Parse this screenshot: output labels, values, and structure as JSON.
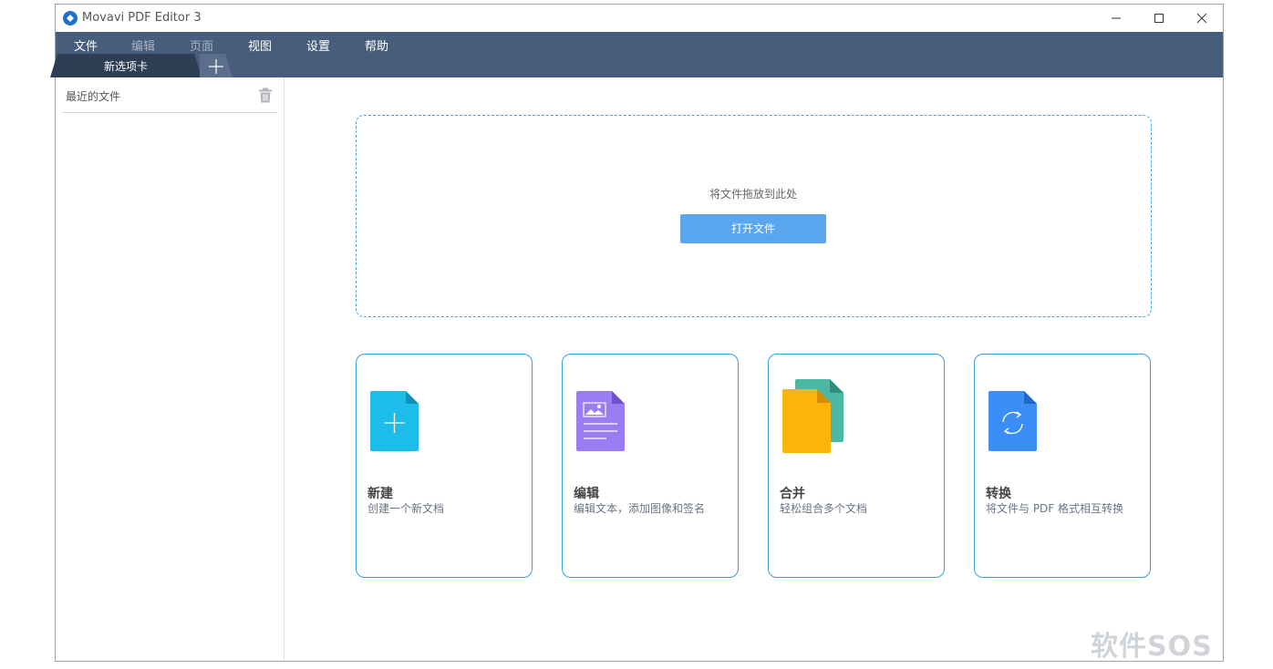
{
  "window": {
    "title": "Movavi PDF Editor 3"
  },
  "menu": {
    "items": [
      {
        "label": "文件",
        "enabled": true
      },
      {
        "label": "编辑",
        "enabled": false
      },
      {
        "label": "页面",
        "enabled": false
      },
      {
        "label": "视图",
        "enabled": true
      },
      {
        "label": "设置",
        "enabled": true
      },
      {
        "label": "帮助",
        "enabled": true
      }
    ]
  },
  "tabs": {
    "active_label": "新选项卡"
  },
  "sidebar": {
    "title": "最近的文件"
  },
  "dropzone": {
    "hint": "将文件拖放到此处",
    "open_button": "打开文件"
  },
  "cards": [
    {
      "title": "新建",
      "desc": "创建一个新文档",
      "icon": "new-document-icon",
      "color": "#1ebde9"
    },
    {
      "title": "编辑",
      "desc": "编辑文本，添加图像和签名",
      "icon": "edit-document-icon",
      "color": "#9b7cf2"
    },
    {
      "title": "合并",
      "desc": "轻松组合多个文档",
      "icon": "merge-documents-icon",
      "color": "#fbb40a"
    },
    {
      "title": "转换",
      "desc": "将文件与 PDF 格式相互转换",
      "icon": "convert-document-icon",
      "color": "#3a8ef5"
    }
  ],
  "watermark": "软件SOS",
  "colors": {
    "menubar": "#475d7c",
    "accent": "#4aa3e0",
    "button": "#5aa7ef"
  }
}
